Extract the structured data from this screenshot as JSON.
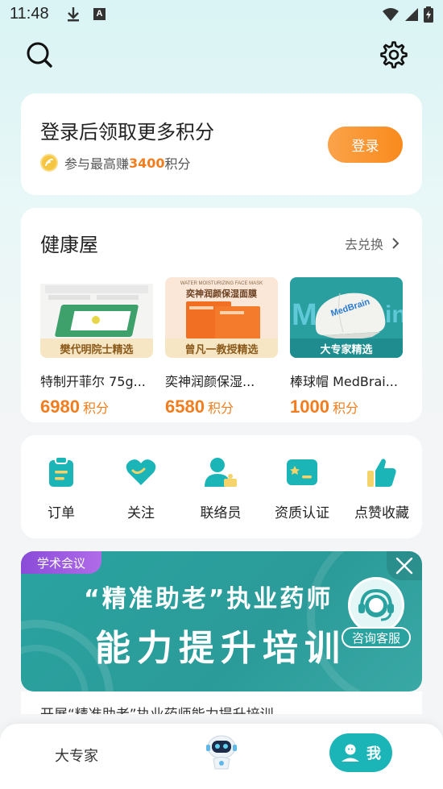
{
  "status_bar": {
    "time": "11:48",
    "notif_a": "A"
  },
  "header": {
    "search_icon": "search-icon",
    "settings_icon": "gear-icon"
  },
  "login_card": {
    "title": "登录后领取更多积分",
    "sub_prefix": "参与最高赚",
    "sub_points": "3400",
    "sub_suffix": "积分",
    "button": "登录"
  },
  "health_house": {
    "title": "健康屋",
    "link": "去兑换",
    "products": [
      {
        "tag": "樊代明院士精选",
        "name": "特制开菲尔 75g...",
        "points": "6980",
        "unit": "积分"
      },
      {
        "tag": "曾凡一教授精选",
        "name": "奕神润颜保湿...",
        "points": "6580",
        "unit": "积分"
      },
      {
        "tag": "大专家精选",
        "name": "棒球帽 MedBrai...",
        "points": "1000",
        "unit": "积分"
      }
    ],
    "product_img_text": {
      "p2_top": "WATER MOISTURIZING FACE MASK",
      "p2_main": "奕神润颜保湿面膜",
      "p3_logo": "MedBrain"
    }
  },
  "menu": {
    "items": [
      {
        "label": "订单",
        "icon": "order-icon"
      },
      {
        "label": "关注",
        "icon": "heart-icon"
      },
      {
        "label": "联络员",
        "icon": "contact-icon"
      },
      {
        "label": "资质认证",
        "icon": "certificate-icon"
      },
      {
        "label": "点赞收藏",
        "icon": "thumbs-up-icon"
      }
    ]
  },
  "banner": {
    "tag": "学术会议",
    "line1": "“精准助老”执业药师",
    "line2": "能力提升培训",
    "caption": "开展“精准助老”执业药师能力提升培训"
  },
  "customer_service": {
    "label": "咨询客服"
  },
  "tabbar": {
    "expert": "大专家",
    "me": "我"
  },
  "colors": {
    "accent": "#f27d1e",
    "teal": "#1bb5b8",
    "banner": "#2aa3a0"
  }
}
